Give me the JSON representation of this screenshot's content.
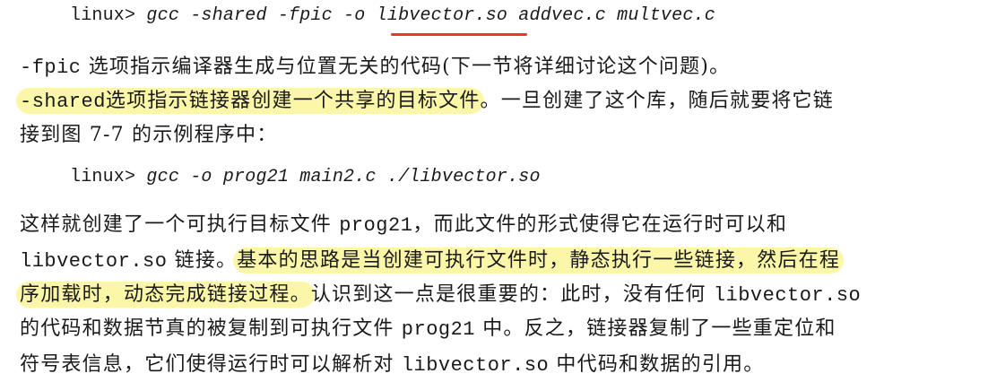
{
  "cmd1": {
    "prompt": "linux>",
    "args_before": "gcc -shared -fpic -o ",
    "target": "libvector.so",
    "args_after": " addvec.c multvec.c"
  },
  "para1": {
    "l1_a": "-fpic",
    "l1_b": " 选项指示编译器生成与位置无关的代码(下一节将详细讨论这个问题)。",
    "l2_hl_mono": "-shared",
    "l2_hl_text": "选项指示链接器创建一个共享的目标文件",
    "l2_rest": "。一旦创建了这个库，随后就要将它链",
    "l3": "接到图 7-7 的示例程序中："
  },
  "cmd2": {
    "prompt": "linux>",
    "args": "gcc -o prog21 main2.c ./libvector.so"
  },
  "para2": {
    "l1_a": "这样就创建了一个可执行目标文件 ",
    "l1_mono": "prog21",
    "l1_b": "，而此文件的形式使得它在运行时可以和",
    "l2_mono": "libvector.so",
    "l2_a": " 链接。",
    "l2_hl": "基本的思路是当创建可执行文件时，静态执行一些链接，然后在程",
    "l3_hl": "序加载时，动态完成链接过程。",
    "l3_a": "认识到这一点是很重要的：此时，没有任何 ",
    "l3_mono": "libvector.so",
    "l4_a": "的代码和数据节真的被复制到可执行文件 ",
    "l4_mono": "prog21",
    "l4_b": " 中。反之，链接器复制了一些重定位和",
    "l5_a": "符号表信息，它们使得运行时可以解析对 ",
    "l5_mono": "libvector.so",
    "l5_b": " 中代码和数据的引用。"
  },
  "colors": {
    "highlight": "#fbf6a8",
    "underline": "#e23b2e"
  }
}
